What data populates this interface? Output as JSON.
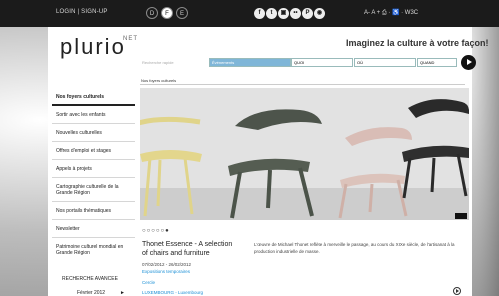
{
  "header": {
    "login_signup": "LOGIN | SIGN-UP",
    "lang": [
      "D",
      "F",
      "E"
    ],
    "social": [
      "f",
      "t",
      "▣",
      "••",
      "P",
      "◉"
    ],
    "tools": "A- A + ⎙ · ♿ · W3C"
  },
  "brand": {
    "logo": "plurio",
    "logo_suffix": "NET",
    "tagline": "Imaginez la culture à votre façon!"
  },
  "search": {
    "label": "Recherche rapide",
    "domain": "Événements",
    "what_placeholder": "QUOI",
    "where_placeholder": "OÙ",
    "when_placeholder": "QUAND"
  },
  "breadcrumb": "Nos foyers culturels",
  "sidebar": {
    "items": [
      {
        "label": "Nos foyers culturels"
      },
      {
        "label": "Sortir avec les enfants"
      },
      {
        "label": "Nouvelles culturelles"
      },
      {
        "label": "Offres d'emploi et stages"
      },
      {
        "label": "Appels à projets"
      },
      {
        "label": "Cartographie culturelle de la Grande Région"
      },
      {
        "label": "Nos portails thématiques"
      },
      {
        "label": "Newsletter"
      },
      {
        "label": "Patrimoine culturel mondial en Grande Région"
      }
    ],
    "advanced": "RECHERCHE AVANCEE",
    "month": "Février 2012",
    "month_arrow": "►"
  },
  "feature": {
    "dots": "○○○○○●",
    "title": "Thonet Essence - A selection of chairs and furniture",
    "dates": "07/02/2012 - 26/02/2012",
    "category": "Expositions temporaires",
    "sub": "Cercle",
    "location": "LUXEMBOURG - Luxembourg",
    "description": "L'œuvre de Michael Thonet reflète à merveille le passage, au cours du XIXe siècle, de l'artisanat à la production industrielle de masse."
  },
  "colors": {
    "accent": "#1a8fd6",
    "search_domain": "#7fb6d8",
    "topbar": "#1b1b1b"
  }
}
